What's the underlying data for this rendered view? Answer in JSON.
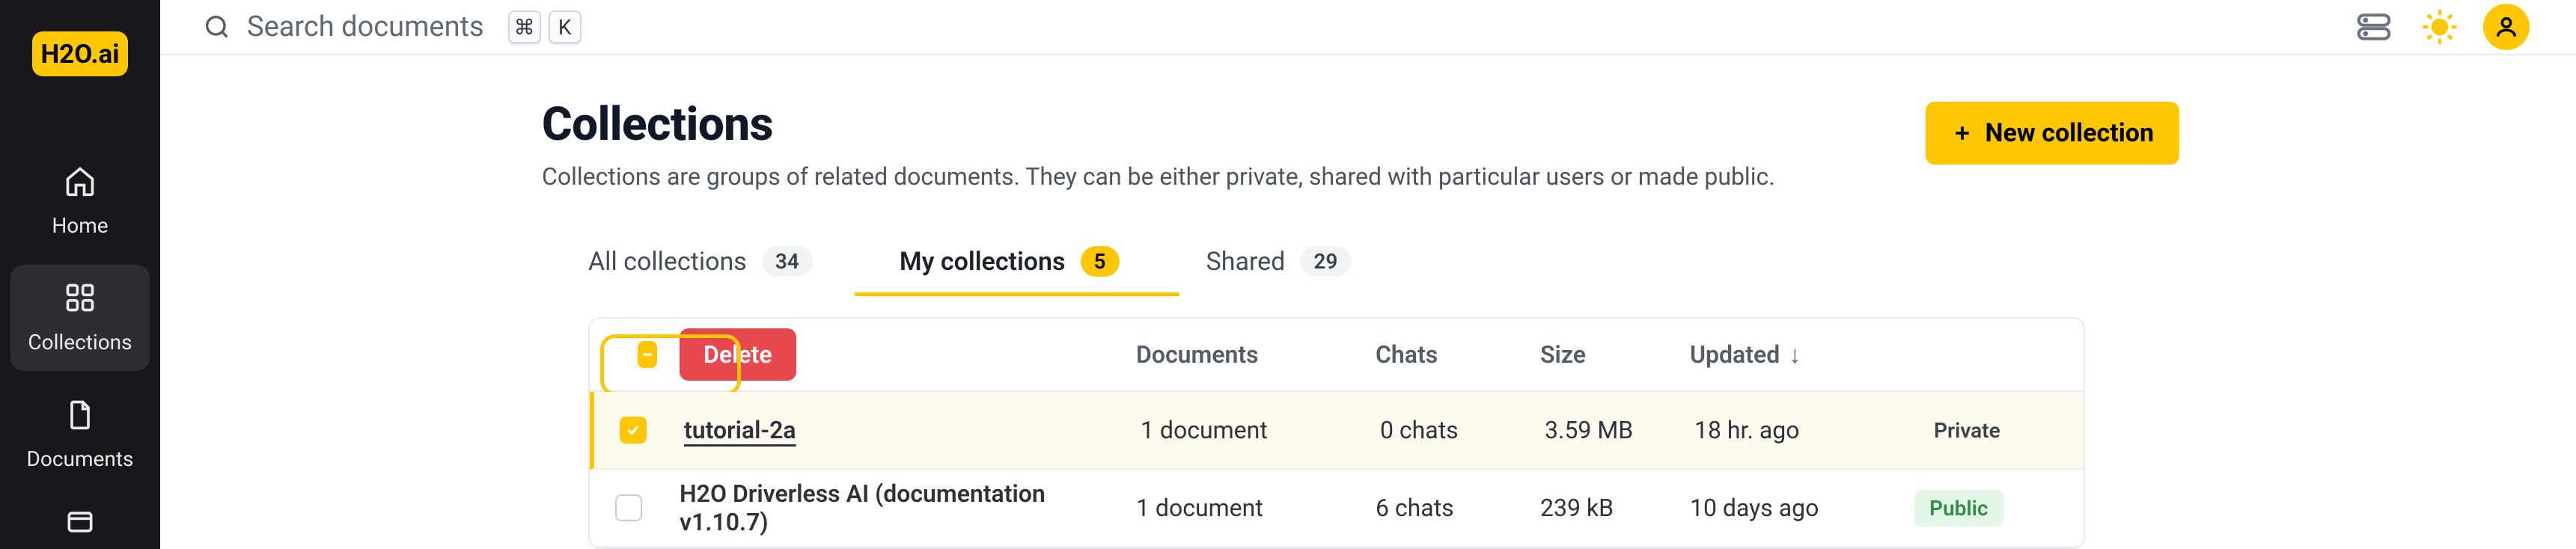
{
  "brand": "H2O.ai",
  "nav": {
    "home": "Home",
    "collections": "Collections",
    "documents": "Documents"
  },
  "search": {
    "placeholder": "Search documents",
    "key1": "⌘",
    "key2": "K"
  },
  "page": {
    "title": "Collections",
    "subtitle": "Collections are groups of related documents. They can be either private, shared with particular users or made public.",
    "new_button": "New collection"
  },
  "tabs": {
    "all": {
      "label": "All collections",
      "count": "34"
    },
    "mine": {
      "label": "My collections",
      "count": "5"
    },
    "shared": {
      "label": "Shared",
      "count": "29"
    }
  },
  "table": {
    "delete_label": "Delete",
    "columns": {
      "documents": "Documents",
      "chats": "Chats",
      "size": "Size",
      "updated": "Updated"
    },
    "rows": [
      {
        "name": "tutorial-2a",
        "documents": "1 document",
        "chats": "0 chats",
        "size": "3.59 MB",
        "updated": "18 hr. ago",
        "visibility": "Private",
        "selected": true
      },
      {
        "name": "H2O Driverless AI (documentation v1.10.7)",
        "documents": "1 document",
        "chats": "6 chats",
        "size": "239 kB",
        "updated": "10 days ago",
        "visibility": "Public",
        "selected": false
      }
    ]
  }
}
